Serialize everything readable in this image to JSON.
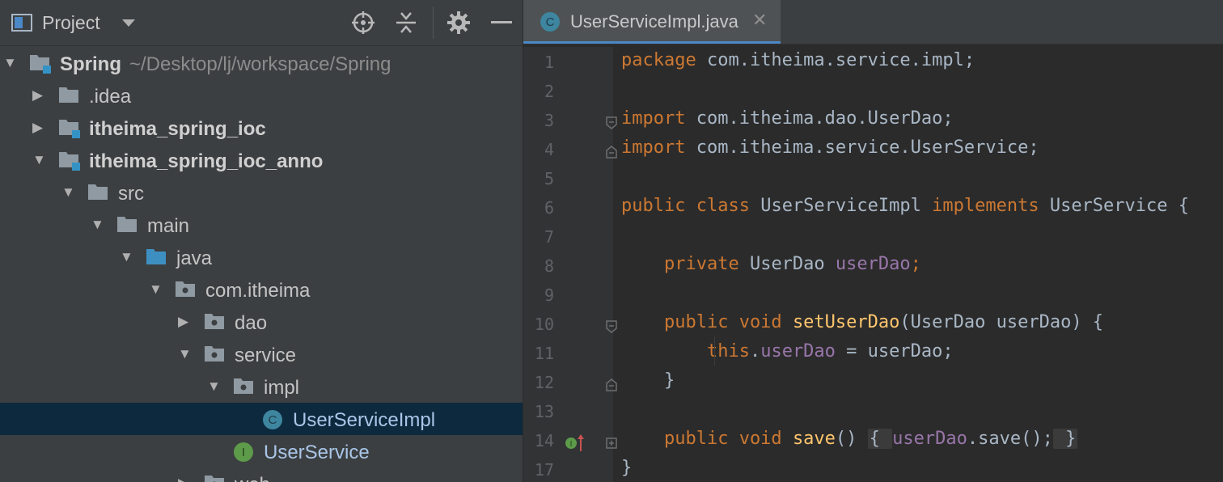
{
  "project_panel": {
    "title": "Project",
    "tree": [
      {
        "label": "Spring",
        "path": "~/Desktop/lj/workspace/Spring",
        "depth": 0,
        "expanded": true,
        "icon": "module-folder",
        "bold": true
      },
      {
        "label": ".idea",
        "depth": 1,
        "expanded": false,
        "icon": "folder"
      },
      {
        "label": "itheima_spring_ioc",
        "depth": 1,
        "expanded": false,
        "icon": "module-folder",
        "bold": true
      },
      {
        "label": "itheima_spring_ioc_anno",
        "depth": 1,
        "expanded": true,
        "icon": "module-folder",
        "bold": true
      },
      {
        "label": "src",
        "depth": 2,
        "expanded": true,
        "icon": "folder"
      },
      {
        "label": "main",
        "depth": 3,
        "expanded": true,
        "icon": "folder"
      },
      {
        "label": "java",
        "depth": 4,
        "expanded": true,
        "icon": "source-folder"
      },
      {
        "label": "com.itheima",
        "depth": 5,
        "expanded": true,
        "icon": "package"
      },
      {
        "label": "dao",
        "depth": 6,
        "expanded": false,
        "icon": "package"
      },
      {
        "label": "service",
        "depth": 6,
        "expanded": true,
        "icon": "package"
      },
      {
        "label": "impl",
        "depth": 7,
        "expanded": true,
        "icon": "package"
      },
      {
        "label": "UserServiceImpl",
        "depth": 8,
        "icon": "class",
        "selected": true
      },
      {
        "label": "UserService",
        "depth": 7,
        "icon": "interface"
      },
      {
        "label": "web",
        "depth": 6,
        "expanded": false,
        "icon": "package"
      }
    ]
  },
  "editor": {
    "tab": {
      "label": "UserServiceImpl.java",
      "close": "✕",
      "icon_letter": "C"
    },
    "lines": [
      {
        "num": "1",
        "tokens": [
          {
            "t": "package",
            "c": "kw"
          },
          {
            "t": " com.itheima.service.impl;",
            "c": ""
          }
        ]
      },
      {
        "num": "2",
        "tokens": []
      },
      {
        "num": "3",
        "tokens": [
          {
            "t": "import",
            "c": "kw"
          },
          {
            "t": " com.itheima.dao.UserDao;",
            "c": ""
          }
        ]
      },
      {
        "num": "4",
        "tokens": [
          {
            "t": "import",
            "c": "kw"
          },
          {
            "t": " com.itheima.service.UserService;",
            "c": ""
          }
        ]
      },
      {
        "num": "5",
        "tokens": []
      },
      {
        "num": "6",
        "tokens": [
          {
            "t": "public class",
            "c": "kw"
          },
          {
            "t": " UserServiceImpl ",
            "c": ""
          },
          {
            "t": "implements",
            "c": "kw"
          },
          {
            "t": " UserService {",
            "c": ""
          }
        ]
      },
      {
        "num": "7",
        "tokens": []
      },
      {
        "num": "8",
        "tokens": [
          {
            "t": "    private",
            "c": "kw"
          },
          {
            "t": " UserDao ",
            "c": ""
          },
          {
            "t": "userDao",
            "c": "fld"
          },
          {
            "t": ";",
            "c": "kw"
          }
        ]
      },
      {
        "num": "9",
        "tokens": []
      },
      {
        "num": "10",
        "tokens": [
          {
            "t": "    public void",
            "c": "kw"
          },
          {
            "t": " ",
            "c": ""
          },
          {
            "t": "setUserDao",
            "c": "fn"
          },
          {
            "t": "(UserDao userDao) {",
            "c": ""
          }
        ]
      },
      {
        "num": "11",
        "tokens": [
          {
            "t": "        this",
            "c": "kw"
          },
          {
            "t": ".",
            "c": ""
          },
          {
            "t": "userDao",
            "c": "fld"
          },
          {
            "t": " = userDao;",
            "c": ""
          }
        ]
      },
      {
        "num": "12",
        "tokens": [
          {
            "t": "    }",
            "c": ""
          }
        ]
      },
      {
        "num": "13",
        "tokens": []
      },
      {
        "num": "14",
        "tokens": [
          {
            "t": "    public void",
            "c": "kw"
          },
          {
            "t": " ",
            "c": ""
          },
          {
            "t": "save",
            "c": "fn"
          },
          {
            "t": "() ",
            "c": ""
          },
          {
            "t": "{ ",
            "c": "box"
          },
          {
            "t": "userDao",
            "c": "fld"
          },
          {
            "t": ".save();",
            "c": ""
          },
          {
            "t": " }",
            "c": "box"
          }
        ]
      },
      {
        "num": "17",
        "tokens": [
          {
            "t": "}",
            "c": ""
          }
        ]
      }
    ]
  },
  "colors": {
    "keyword": "#cc7832",
    "function": "#ffc66d",
    "field": "#9876aa",
    "selection": "#0d293e",
    "tab_underline": "#4a88c7"
  },
  "icons": [
    "project-view-icon",
    "dropdown-icon",
    "locate-icon",
    "collapse-all-icon",
    "settings-icon",
    "hide-icon",
    "class-icon",
    "interface-icon",
    "implements-gutter-icon"
  ]
}
